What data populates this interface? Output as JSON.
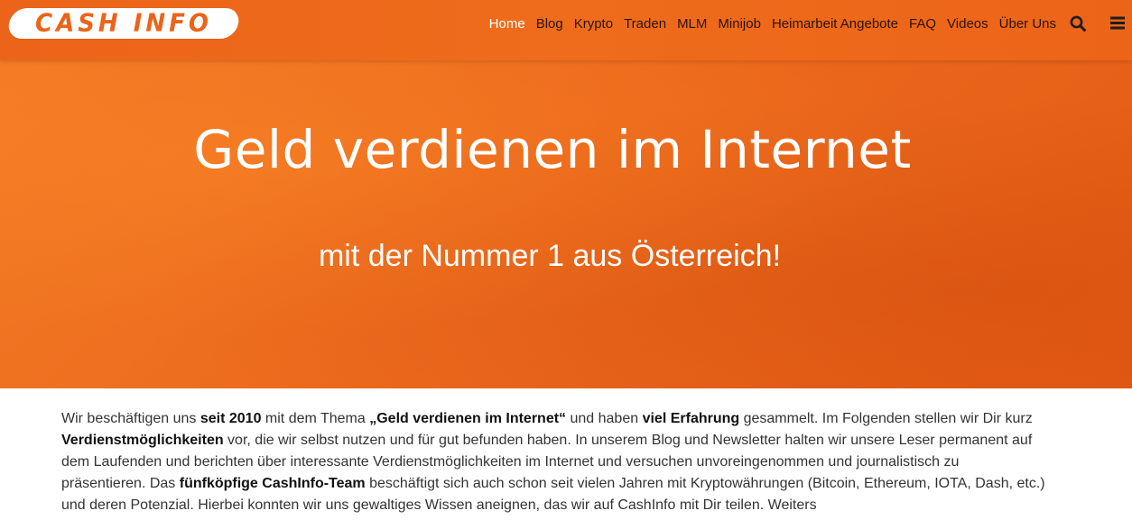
{
  "logo": {
    "text": "Cash Info"
  },
  "nav": {
    "items": [
      {
        "label": "Home",
        "active": true
      },
      {
        "label": "Blog"
      },
      {
        "label": "Krypto"
      },
      {
        "label": "Traden"
      },
      {
        "label": "MLM"
      },
      {
        "label": "Minijob"
      },
      {
        "label": "Heimarbeit Angebote"
      },
      {
        "label": "FAQ"
      },
      {
        "label": "Videos"
      },
      {
        "label": "Über Uns"
      }
    ],
    "search_icon": "search-icon",
    "menu_icon": "hamburger-menu-icon"
  },
  "hero": {
    "title": "Geld verdienen im Internet",
    "subtitle": "mit der Nummer 1 aus Österreich!"
  },
  "intro": {
    "t1": "Wir beschäftigen uns ",
    "b1": "seit 2010",
    "t2": " mit dem Thema ",
    "b2": "„Geld verdienen im Internet“",
    "t3": " und haben ",
    "b3": "viel Erfahrung",
    "t4": " gesammelt. Im Folgenden stellen wir Dir kurz ",
    "b4": "Verdienstmöglichkeiten",
    "t5": " vor, die wir selbst nutzen und für gut befunden haben. In unserem Blog und Newsletter halten wir unsere Leser permanent auf dem Laufenden und berichten über interessante Verdienstmöglichkeiten im Internet und versuchen unvoreingenommen und journalistisch zu präsentieren. Das ",
    "b5": "fünfköpfige CashInfo-Team",
    "t6": " beschäftigt sich auch schon seit vielen Jahren mit Kryptowährungen (Bitcoin, Ethereum, IOTA, Dash, etc.) und deren Potenzial. Hierbei konnten wir uns gewaltiges Wissen aneignen, das wir auf CashInfo mit Dir teilen. Weiters"
  },
  "colors": {
    "brand_orange": "#ec6419",
    "nav_text": "#2b1406",
    "nav_active": "#ffffff",
    "body_text": "#333333"
  }
}
